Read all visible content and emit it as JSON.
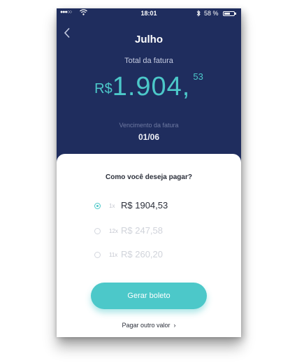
{
  "status_bar": {
    "signal": "●●●○○",
    "wifi_icon": "wifi-icon",
    "time": "18:01",
    "bluetooth_icon": "bluetooth-icon",
    "battery_text": "58 %",
    "battery_level": 0.58
  },
  "header": {
    "back_icon": "chevron-left-icon",
    "title": "Julho",
    "total_label": "Total da fatura",
    "currency": "R$",
    "amount_integer": "1.904,",
    "amount_cents": "53",
    "due_label": "Vencimento da fatura",
    "due_date": "01/06"
  },
  "payment": {
    "question": "Como você deseja pagar?",
    "options": [
      {
        "installments": "1x",
        "value": "R$ 1904,53",
        "selected": true
      },
      {
        "installments": "12x",
        "value": "R$ 247,58",
        "selected": false
      },
      {
        "installments": "11x",
        "value": "R$ 260,20",
        "selected": false
      }
    ],
    "primary_button": "Gerar boleto",
    "secondary_link": "Pagar outro valor",
    "secondary_icon": "chevron-right-icon"
  },
  "colors": {
    "header_bg": "#1f2d5e",
    "accent": "#4cc8c9",
    "text_dark": "#2b2f3a",
    "text_muted": "#d0d3da"
  }
}
